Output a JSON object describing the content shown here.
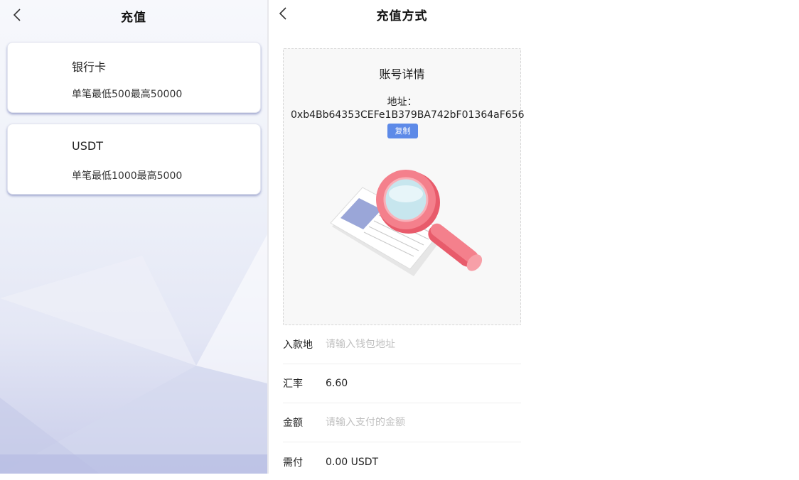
{
  "left_panel": {
    "title": "充值",
    "methods": [
      {
        "name": "银行卡",
        "limit": "单笔最低500最高50000"
      },
      {
        "name": "USDT",
        "limit": "单笔最低1000最高5000"
      }
    ]
  },
  "right_panel": {
    "title": "充值方式",
    "account": {
      "heading": "账号详情",
      "address_label": "地址：",
      "address_value": "0xb4Bb64353CEFe1B379BA742bF01364aF656",
      "copy_label": "复制"
    },
    "illustration_icon": "magnifier-search-illustration",
    "form": {
      "deposit_address": {
        "label": "入款地",
        "placeholder": "请输入钱包地址",
        "value": ""
      },
      "rate": {
        "label": "汇率",
        "value": "6.60"
      },
      "amount": {
        "label": "金额",
        "placeholder": "请输入支付的金额",
        "value": ""
      },
      "payable": {
        "label": "需付",
        "value": "0.00 USDT"
      }
    }
  },
  "colors": {
    "accent": "#5d8ae8",
    "card_shadow": "#7b84c4",
    "magnifier": "#f4707f"
  }
}
